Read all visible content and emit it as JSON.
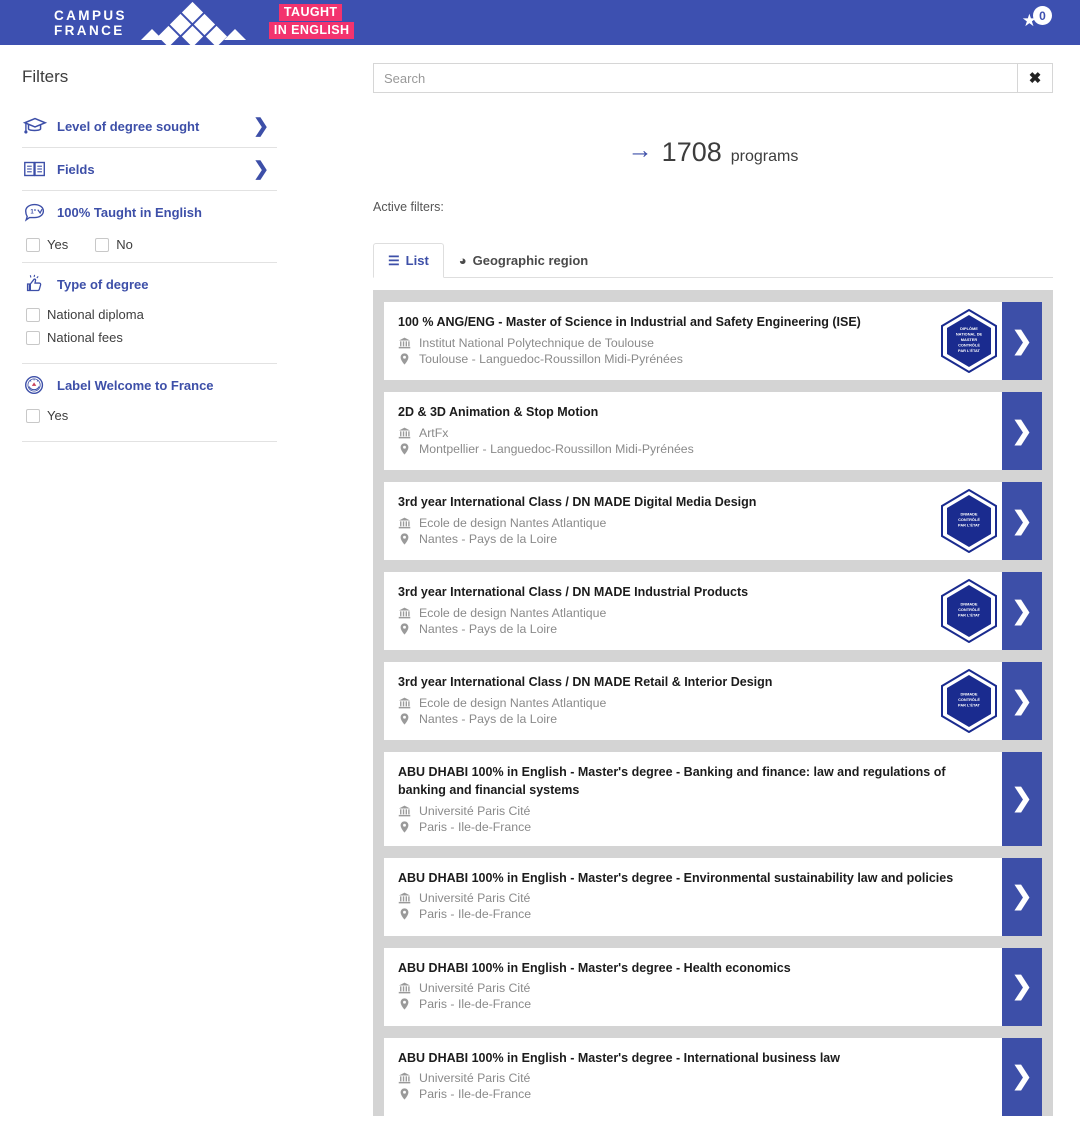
{
  "header": {
    "logo_line1": "CAMPUS",
    "logo_line2": "FRANCE",
    "badge_line1": "TAUGHT",
    "badge_line2": "IN ENGLISH",
    "favorites_count": "0",
    "brand_blue": "#3d50b0",
    "badge_pink": "#f3336e"
  },
  "sidebar": {
    "title": "Filters",
    "groups": [
      {
        "label": "Level of degree sought",
        "icon": "graduation-cap-icon",
        "expandable": true
      },
      {
        "label": "Fields",
        "icon": "open-book-icon",
        "expandable": true
      },
      {
        "label": "100% Taught in English",
        "icon": "speech-bubble-icon",
        "expandable": false,
        "options": [
          {
            "label": "Yes",
            "checked": false
          },
          {
            "label": "No",
            "checked": false
          }
        ]
      },
      {
        "label": "Type of degree",
        "icon": "thumbs-up-icon",
        "expandable": false,
        "options": [
          {
            "label": "National diploma",
            "checked": false
          },
          {
            "label": "National fees",
            "checked": false
          }
        ]
      },
      {
        "label": "Label Welcome to France",
        "icon": "seal-emblem-icon",
        "expandable": false,
        "options": [
          {
            "label": "Yes",
            "checked": false
          }
        ]
      }
    ]
  },
  "search": {
    "value": "",
    "placeholder": "Search",
    "clear_glyph": "✖"
  },
  "results_summary": {
    "arrow": "→",
    "count": "1708",
    "label": "programs"
  },
  "active_filters": {
    "label": "Active filters:"
  },
  "tabs": [
    {
      "label": "List",
      "glyph": "☰",
      "icon": "list-icon",
      "active": true
    },
    {
      "label": "Geographic region",
      "glyph": "◕",
      "icon": "globe-icon",
      "active": false
    }
  ],
  "accent_blue": "#3d4fa8",
  "programs": [
    {
      "title": "100 % ANG/ENG - Master of Science in Industrial and Safety Engineering (ISE)",
      "institution": "Institut National Polytechnique de Toulouse",
      "location": "Toulouse - Languedoc-Roussillon Midi-Pyrénées",
      "badge": [
        "DIPLÔME",
        "NATIONAL DE",
        "MASTER",
        "CONTRÔLÉ",
        "PAR L'ÉTAT"
      ]
    },
    {
      "title": "2D & 3D Animation & Stop Motion",
      "institution": "ArtFx",
      "location": "Montpellier - Languedoc-Roussillon Midi-Pyrénées",
      "badge": null
    },
    {
      "title": "3rd year International Class / DN MADE Digital Media Design",
      "institution": "Ecole de design Nantes Atlantique",
      "location": "Nantes - Pays de la Loire",
      "badge": [
        "DNMADE",
        "CONTRÔLÉ",
        "PAR L'ÉTAT"
      ]
    },
    {
      "title": "3rd year International Class / DN MADE Industrial Products",
      "institution": "Ecole de design Nantes Atlantique",
      "location": "Nantes - Pays de la Loire",
      "badge": [
        "DNMADE",
        "CONTRÔLÉ",
        "PAR L'ÉTAT"
      ]
    },
    {
      "title": "3rd year International Class / DN MADE Retail & Interior Design",
      "institution": "Ecole de design Nantes Atlantique",
      "location": "Nantes - Pays de la Loire",
      "badge": [
        "DNMADE",
        "CONTRÔLÉ",
        "PAR L'ÉTAT"
      ]
    },
    {
      "title": "ABU DHABI 100% in English - Master's degree - Banking and finance: law and regulations of banking and financial systems",
      "institution": "Université Paris Cité",
      "location": "Paris - Ile-de-France",
      "badge": null
    },
    {
      "title": "ABU DHABI 100% in English - Master's degree - Environmental sustainability law and policies",
      "institution": "Université Paris Cité",
      "location": "Paris - Ile-de-France",
      "badge": null
    },
    {
      "title": "ABU DHABI 100% in English - Master's degree - Health economics",
      "institution": "Université Paris Cité",
      "location": "Paris - Ile-de-France",
      "badge": null
    },
    {
      "title": "ABU DHABI 100% in English - Master's degree - International business law",
      "institution": "Université Paris Cité",
      "location": "Paris - Ile-de-France",
      "badge": null
    }
  ]
}
